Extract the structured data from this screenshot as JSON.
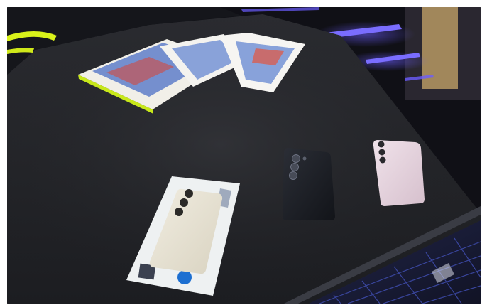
{
  "photo": {
    "kind": "photograph",
    "objects": [
      "black-tabletop",
      "stack-of-brochures",
      "cream-phone-on-display-card",
      "black-phone",
      "pink-phone",
      "neon-ring-light",
      "purple-led-strips",
      "wire-mesh-table-side"
    ]
  },
  "colors": {
    "table": "#222226",
    "table_edge": "#3a3c44",
    "neon_yellow": "#d9f21a",
    "led_purple": "#6b5cff",
    "led_glow": "#2a2bbd",
    "back_wall": "#0f0f15",
    "cream_phone": "#e7e2d2",
    "black_phone": "#1a1c22",
    "pink_phone": "#e7d5df",
    "card_white": "#eef1f2",
    "mesh_blue": "#2f3b8f"
  }
}
